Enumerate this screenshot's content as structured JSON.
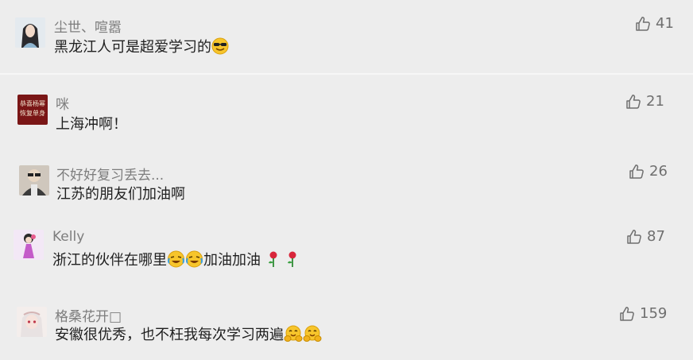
{
  "comments": [
    {
      "nickname": "尘世、喧嚣",
      "text": "黑龙江人可是超爱学习的",
      "emoji_suffix": "sunglasses-emoji",
      "likes": "41"
    },
    {
      "nickname": "咪",
      "text": "上海冲啊！",
      "likes": "21",
      "avatar_text": [
        "恭喜杨幂",
        "恢复单身"
      ]
    },
    {
      "nickname": "不好好复习丢去...",
      "text": "江苏的朋友们加油啊",
      "likes": "26"
    },
    {
      "nickname": "Kelly",
      "text_before": "浙江的伙伴在哪里",
      "text_after": "加油加油",
      "emoji_mid": [
        "crying-laughing-emoji",
        "crying-laughing-emoji"
      ],
      "emoji_end": [
        "rose-emoji",
        "rose-emoji"
      ],
      "likes": "87"
    },
    {
      "nickname": "格桑花开□",
      "text": "安徽很优秀，也不枉我每次学习两遍",
      "emoji_suffix": [
        "hugging-emoji",
        "hugging-emoji"
      ],
      "likes": "159"
    }
  ],
  "colors": {
    "background": "#ededed",
    "nickname": "#7d7d7d",
    "text": "#1f1f1f",
    "like": "#6f6f6f",
    "avatar_red": "#7a1616"
  },
  "icons": {
    "like": "thumbs-up-outline-icon"
  }
}
